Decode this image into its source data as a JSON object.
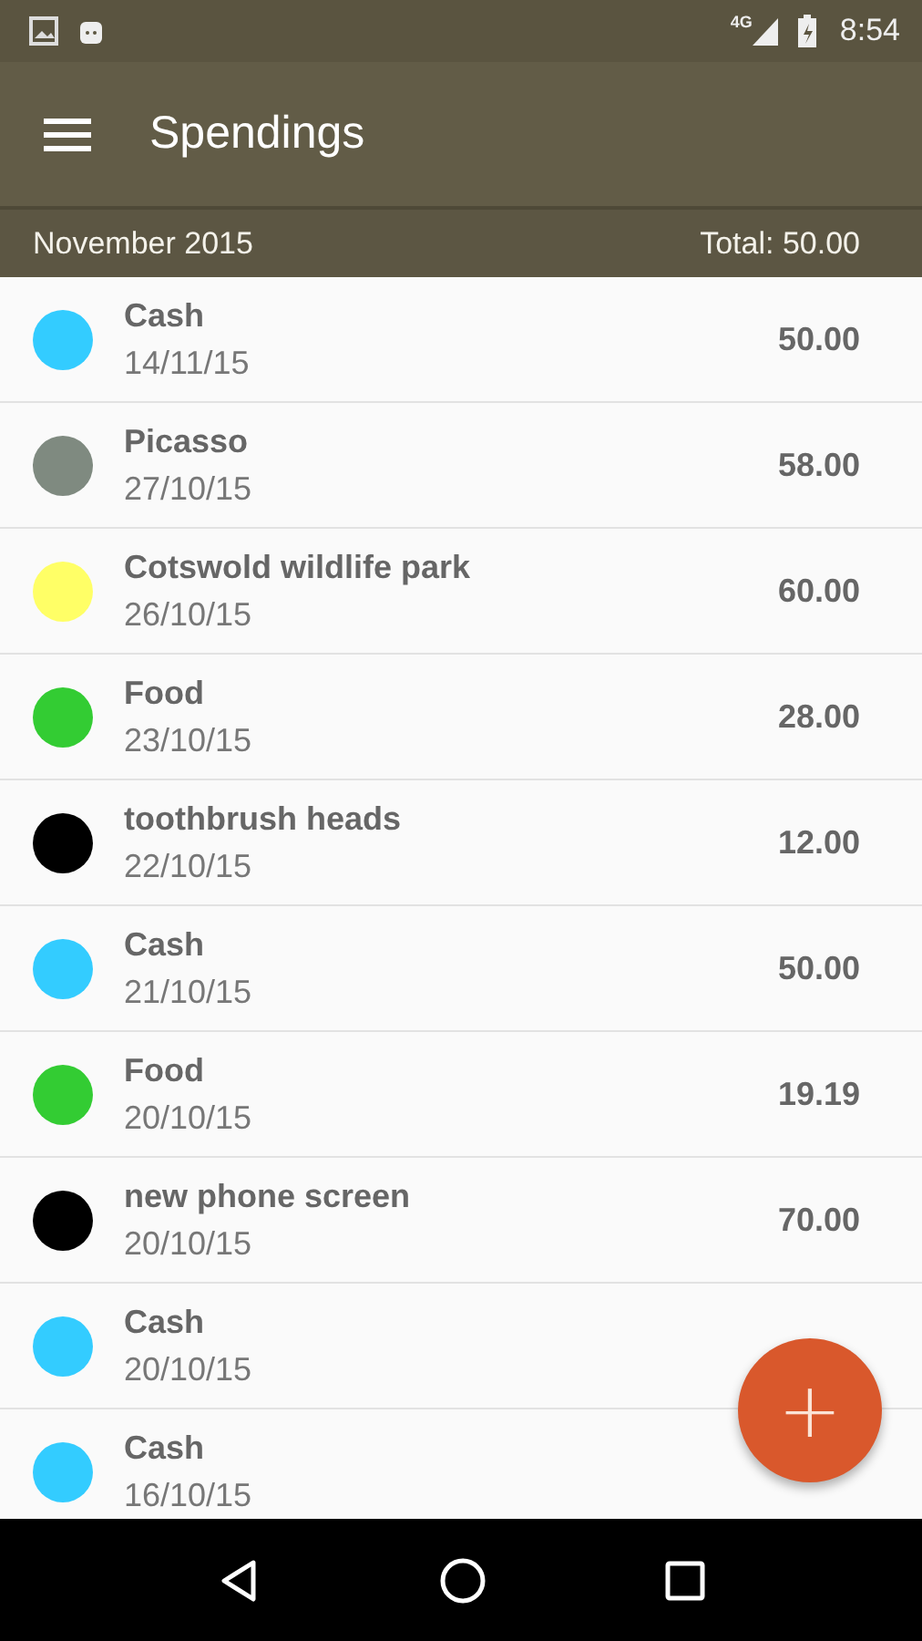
{
  "status_bar": {
    "network": "4G",
    "time": "8:54"
  },
  "toolbar": {
    "title": "Spendings"
  },
  "summary": {
    "period": "November 2015",
    "total": "Total: 50.00"
  },
  "expenses": [
    {
      "name": "Cash",
      "date": "14/11/15",
      "amount": "50.00",
      "color": "#33ccff"
    },
    {
      "name": "Picasso",
      "date": "27/10/15",
      "amount": "58.00",
      "color": "#7f8a80"
    },
    {
      "name": "Cotswold wildlife park",
      "date": "26/10/15",
      "amount": "60.00",
      "color": "#ffff66"
    },
    {
      "name": "Food",
      "date": "23/10/15",
      "amount": "28.00",
      "color": "#33cc33"
    },
    {
      "name": "toothbrush heads",
      "date": "22/10/15",
      "amount": "12.00",
      "color": "#000000"
    },
    {
      "name": "Cash",
      "date": "21/10/15",
      "amount": "50.00",
      "color": "#33ccff"
    },
    {
      "name": "Food",
      "date": "20/10/15",
      "amount": "19.19",
      "color": "#33cc33"
    },
    {
      "name": "new phone screen",
      "date": "20/10/15",
      "amount": "70.00",
      "color": "#000000"
    },
    {
      "name": "Cash",
      "date": "20/10/15",
      "color": "#33ccff"
    },
    {
      "name": "Cash",
      "date": "16/10/15",
      "color": "#33ccff"
    }
  ],
  "fab": {
    "label": "+"
  }
}
